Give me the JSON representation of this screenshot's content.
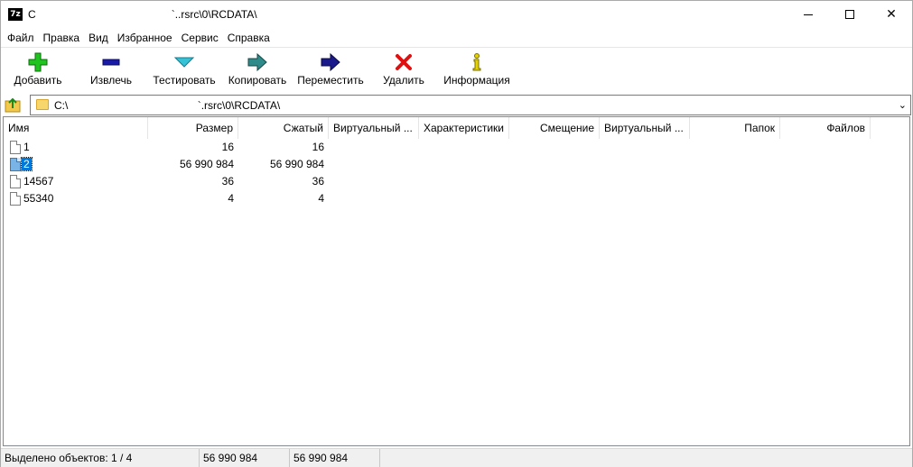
{
  "window": {
    "app_icon_text": "7z",
    "title": "C                                             `..rsrc\\0\\RCDATA\\",
    "controls": {
      "minimize": "—",
      "maximize": "☐",
      "close": "✕"
    }
  },
  "menu": [
    "Файл",
    "Правка",
    "Вид",
    "Избранное",
    "Сервис",
    "Справка"
  ],
  "toolbar": {
    "add": "Добавить",
    "extract": "Извлечь",
    "test": "Тестировать",
    "copy": "Копировать",
    "move": "Переместить",
    "delete": "Удалить",
    "info": "Информация"
  },
  "address": {
    "path": "C:\\                                           `.rsrc\\0\\RCDATA\\"
  },
  "columns": [
    "Имя",
    "Размер",
    "Сжатый",
    "Виртуальный ...",
    "Характеристики",
    "Смещение",
    "Виртуальный ...",
    "Папок",
    "Файлов"
  ],
  "files": [
    {
      "name": "1",
      "size": "16",
      "packed": "16",
      "selected": false
    },
    {
      "name": "2",
      "size": "56 990 984",
      "packed": "56 990 984",
      "selected": true
    },
    {
      "name": "14567",
      "size": "36",
      "packed": "36",
      "selected": false
    },
    {
      "name": "55340",
      "size": "4",
      "packed": "4",
      "selected": false
    }
  ],
  "status": {
    "selected": "Выделено объектов: 1 / 4",
    "size": "56 990 984",
    "packed": "56 990 984"
  },
  "colors": {
    "selection": "#0078d7",
    "add_icon": "#1fc41f",
    "extract_icon": "#1a1aa8",
    "test_icon": "#34c2d6",
    "copy_icon": "#2f8a8a",
    "move_icon": "#1a1a8c",
    "delete_icon": "#e01010",
    "info_icon": "#e6d200"
  }
}
